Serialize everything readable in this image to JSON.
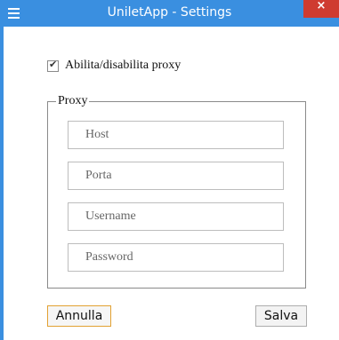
{
  "window": {
    "title": "UniletApp - Settings",
    "close_glyph": "×",
    "accent_color": "#3a8fe0",
    "close_color": "#cf3b30"
  },
  "proxy_toggle": {
    "label": "Abilita/disabilita proxy",
    "checked": true,
    "check_glyph": "✔"
  },
  "proxy": {
    "legend": "Proxy",
    "fields": {
      "host": {
        "value": "",
        "placeholder": "Host"
      },
      "port": {
        "value": "",
        "placeholder": "Porta"
      },
      "username": {
        "value": "",
        "placeholder": "Username"
      },
      "password": {
        "value": "",
        "placeholder": "Password"
      }
    }
  },
  "buttons": {
    "cancel": "Annulla",
    "save": "Salva"
  },
  "icons": {
    "menu": "hamburger-menu-icon",
    "close": "close-icon",
    "check": "checkmark-icon"
  }
}
